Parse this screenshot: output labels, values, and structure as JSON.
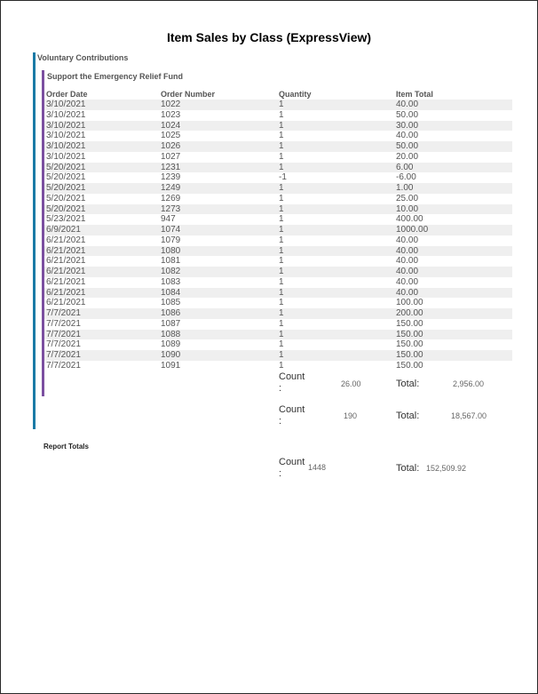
{
  "report": {
    "title": "Item Sales by Class (ExpressView)",
    "class_name": "Voluntary Contributions",
    "item_name": "Support the Emergency Relief Fund"
  },
  "columns": {
    "order_date": "Order Date",
    "order_number": "Order Number",
    "quantity": "Quantity",
    "item_total": "Item Total"
  },
  "rows": [
    {
      "date": "3/10/2021",
      "number": "1022",
      "qty": "1",
      "total": "40.00"
    },
    {
      "date": "3/10/2021",
      "number": "1023",
      "qty": "1",
      "total": "50.00"
    },
    {
      "date": "3/10/2021",
      "number": "1024",
      "qty": "1",
      "total": "30.00"
    },
    {
      "date": "3/10/2021",
      "number": "1025",
      "qty": "1",
      "total": "40.00"
    },
    {
      "date": "3/10/2021",
      "number": "1026",
      "qty": "1",
      "total": "50.00"
    },
    {
      "date": "3/10/2021",
      "number": "1027",
      "qty": "1",
      "total": "20.00"
    },
    {
      "date": "5/20/2021",
      "number": "1231",
      "qty": "1",
      "total": "6.00"
    },
    {
      "date": "5/20/2021",
      "number": "1239",
      "qty": "-1",
      "total": "-6.00"
    },
    {
      "date": "5/20/2021",
      "number": "1249",
      "qty": "1",
      "total": "1.00"
    },
    {
      "date": "5/20/2021",
      "number": "1269",
      "qty": "1",
      "total": "25.00"
    },
    {
      "date": "5/20/2021",
      "number": "1273",
      "qty": "1",
      "total": "10.00"
    },
    {
      "date": "5/23/2021",
      "number": "947",
      "qty": "1",
      "total": "400.00"
    },
    {
      "date": "6/9/2021",
      "number": "1074",
      "qty": "1",
      "total": "1000.00"
    },
    {
      "date": "6/21/2021",
      "number": "1079",
      "qty": "1",
      "total": "40.00"
    },
    {
      "date": "6/21/2021",
      "number": "1080",
      "qty": "1",
      "total": "40.00"
    },
    {
      "date": "6/21/2021",
      "number": "1081",
      "qty": "1",
      "total": "40.00"
    },
    {
      "date": "6/21/2021",
      "number": "1082",
      "qty": "1",
      "total": "40.00"
    },
    {
      "date": "6/21/2021",
      "number": "1083",
      "qty": "1",
      "total": "40.00"
    },
    {
      "date": "6/21/2021",
      "number": "1084",
      "qty": "1",
      "total": "40.00"
    },
    {
      "date": "6/21/2021",
      "number": "1085",
      "qty": "1",
      "total": "100.00"
    },
    {
      "date": "7/7/2021",
      "number": "1086",
      "qty": "1",
      "total": "200.00"
    },
    {
      "date": "7/7/2021",
      "number": "1087",
      "qty": "1",
      "total": "150.00"
    },
    {
      "date": "7/7/2021",
      "number": "1088",
      "qty": "1",
      "total": "150.00"
    },
    {
      "date": "7/7/2021",
      "number": "1089",
      "qty": "1",
      "total": "150.00"
    },
    {
      "date": "7/7/2021",
      "number": "1090",
      "qty": "1",
      "total": "150.00"
    },
    {
      "date": "7/7/2021",
      "number": "1091",
      "qty": "1",
      "total": "150.00"
    }
  ],
  "labels": {
    "count": "Count\n:",
    "total": "Total:",
    "report_totals": "Report Totals"
  },
  "item_subtotal": {
    "count": "26.00",
    "total": "2,956.00"
  },
  "class_subtotal": {
    "count": "190",
    "total": "18,567.00"
  },
  "report_totals": {
    "count": "1448",
    "total": "152,509.92"
  }
}
